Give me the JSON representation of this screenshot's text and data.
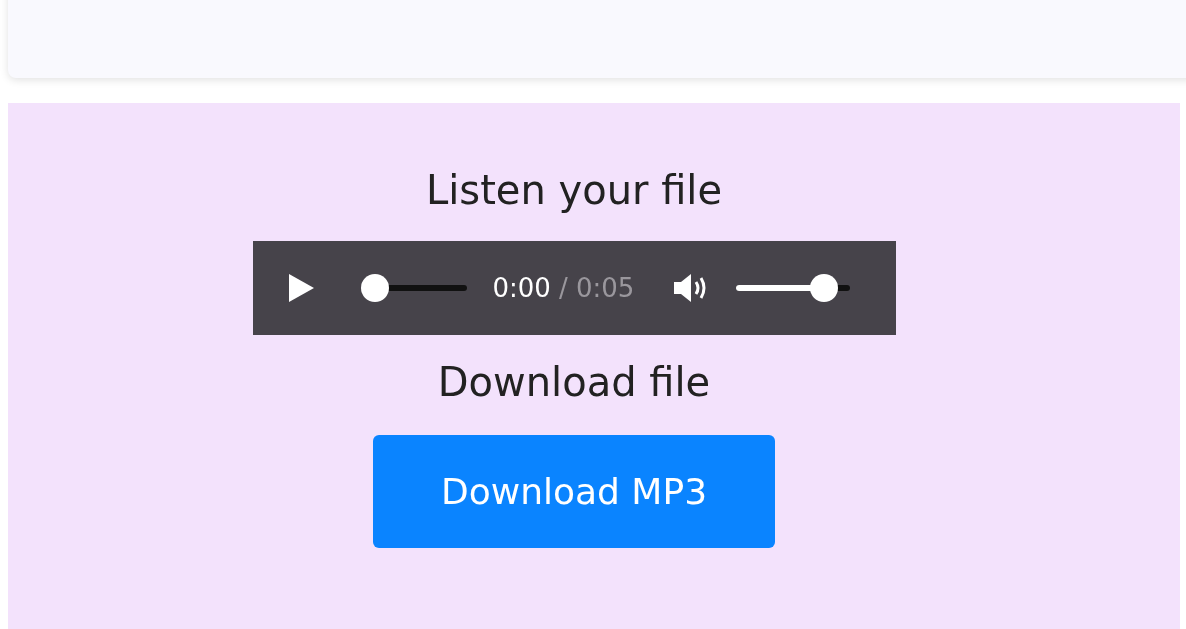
{
  "listen_heading": "Listen your file",
  "player": {
    "elapsed": "0:00",
    "duration": "/ 0:05",
    "progress": {
      "level": 0
    },
    "volume": {
      "level": 0.86
    }
  },
  "download_heading": "Download file",
  "download_button": {
    "label": "Download MP3"
  }
}
